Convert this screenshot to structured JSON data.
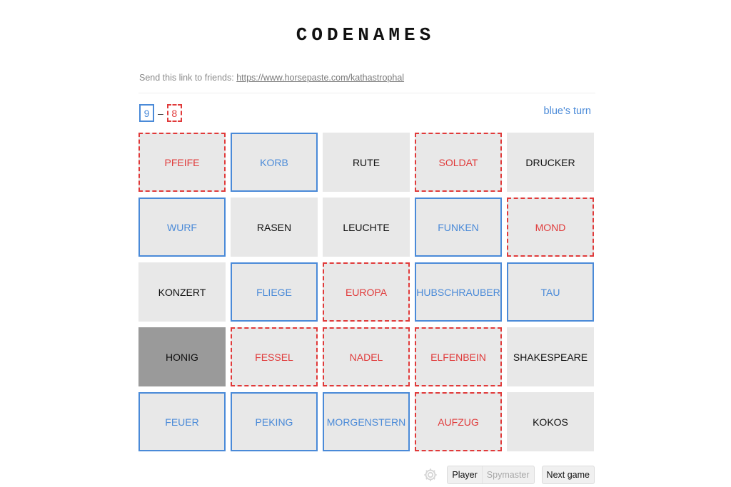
{
  "header": {
    "title": "CODENAMES"
  },
  "share": {
    "label": "Send this link to friends:",
    "link": "https://www.horsepaste.com/kathastrophal"
  },
  "score": {
    "blue": "9",
    "separator": "–",
    "red": "8"
  },
  "turn": {
    "text": "blue's turn",
    "color": "#4a8ad8"
  },
  "colors": {
    "blue": "#4a8ad8",
    "red": "#e03a3a",
    "neutral_bg": "#e8e8e8",
    "assassin_bg": "#9a9a9a"
  },
  "board": [
    {
      "word": "PFEIFE",
      "team": "red"
    },
    {
      "word": "KORB",
      "team": "blue"
    },
    {
      "word": "RUTE",
      "team": "neutral"
    },
    {
      "word": "SOLDAT",
      "team": "red"
    },
    {
      "word": "DRUCKER",
      "team": "neutral"
    },
    {
      "word": "WURF",
      "team": "blue"
    },
    {
      "word": "RASEN",
      "team": "neutral"
    },
    {
      "word": "LEUCHTE",
      "team": "neutral"
    },
    {
      "word": "FUNKEN",
      "team": "blue"
    },
    {
      "word": "MOND",
      "team": "red"
    },
    {
      "word": "KONZERT",
      "team": "neutral"
    },
    {
      "word": "FLIEGE",
      "team": "blue"
    },
    {
      "word": "EUROPA",
      "team": "red"
    },
    {
      "word": "HUBSCHRAUBER",
      "team": "blue"
    },
    {
      "word": "TAU",
      "team": "blue"
    },
    {
      "word": "HONIG",
      "team": "assassin"
    },
    {
      "word": "FESSEL",
      "team": "red"
    },
    {
      "word": "NADEL",
      "team": "red"
    },
    {
      "word": "ELFENBEIN",
      "team": "red"
    },
    {
      "word": "SHAKESPEARE",
      "team": "neutral"
    },
    {
      "word": "FEUER",
      "team": "blue"
    },
    {
      "word": "PEKING",
      "team": "blue"
    },
    {
      "word": "MORGENSTERN",
      "team": "blue"
    },
    {
      "word": "AUFZUG",
      "team": "red"
    },
    {
      "word": "KOKOS",
      "team": "neutral"
    }
  ],
  "footer": {
    "settings_icon": "gear-icon",
    "role_options": [
      "Player",
      "Spymaster"
    ],
    "selected_role": "Player",
    "next_game_label": "Next game"
  }
}
